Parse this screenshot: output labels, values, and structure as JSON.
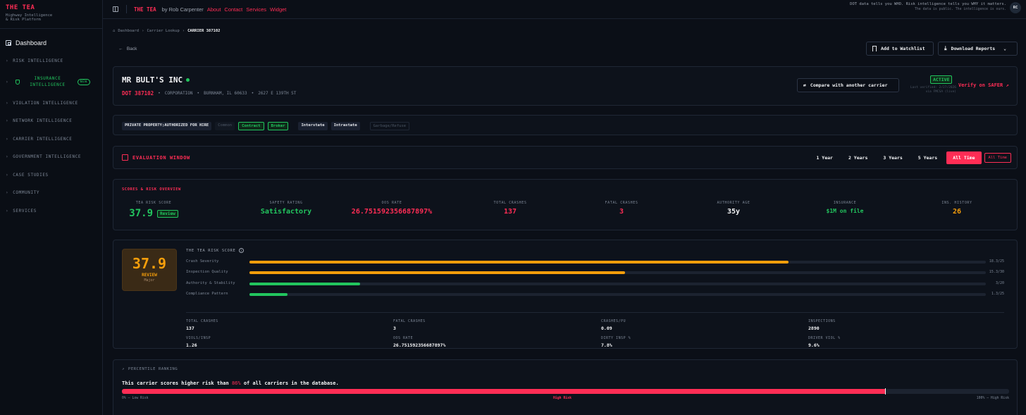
{
  "brand": {
    "title": "THE TEA",
    "subtitle_line1": "Highway Intelligence",
    "subtitle_line2": "& Risk Platform"
  },
  "sidebar": {
    "dashboard": "Dashboard",
    "items": [
      {
        "label": "RISK INTELLIGENCE"
      },
      {
        "label_line1": "INSURANCE",
        "label_line2": "INTELLIGENCE",
        "badge": "NEW",
        "active": true
      },
      {
        "label": "VIOLATION INTELLIGENCE"
      },
      {
        "label": "NETWORK INTELLIGENCE"
      },
      {
        "label": "CARRIER INTELLIGENCE"
      },
      {
        "label": "GOVERNMENT INTELLIGENCE"
      },
      {
        "label": "CASE STUDIES"
      },
      {
        "label": "COMMUNITY"
      },
      {
        "label": "SERVICES"
      }
    ]
  },
  "topbar": {
    "brand": "THE TEA",
    "by": "by Rob Carpenter",
    "links": [
      "About",
      "Contact",
      "Services",
      "Widget"
    ],
    "tagline1": "DOT data tells you WHO. Risk intelligence tells you WHY it matters.",
    "tagline2": "The data is public. The intelligence is ours.",
    "avatar": "RC"
  },
  "breadcrumb": {
    "home": "Dashboard",
    "mid": "Carrier Lookup",
    "current": "CARRIER 387102"
  },
  "back": "Back",
  "buttons": {
    "watchlist": "Add to Watchlist",
    "download": "Download Reports",
    "compare": "Compare with another carrier"
  },
  "carrier": {
    "name": "MR BULT'S INC",
    "dot": "DOT 387102",
    "type": "CORPORATION",
    "city": "BURNHAM, IL 60633",
    "address": "2627 E 139TH ST",
    "status": "ACTIVE",
    "verified_line1": "Last verified: 2/27/2026",
    "verified_line2": "via FMCSA (live)",
    "verify_link": "Verify on SAFER"
  },
  "tags": [
    {
      "text": "PRIVATE PROPERTY;AUTHORIZED FOR HIRE",
      "style": "solid"
    },
    {
      "text": "Common",
      "style": "muted"
    },
    {
      "text": "Contract",
      "style": "green"
    },
    {
      "text": "Broker",
      "style": "green"
    },
    {
      "text": "Interstate",
      "style": "solid"
    },
    {
      "text": "Intrastate",
      "style": "solid"
    },
    {
      "text": "Garbage/Refuse",
      "style": "faded"
    }
  ],
  "evaluation": {
    "title": "EVALUATION WINDOW",
    "ranges": [
      "1 Year",
      "2 Years",
      "3 Years",
      "5 Years",
      "All Time"
    ],
    "selected": "All Time",
    "badge": "All Time"
  },
  "overview": {
    "title": "SCORES & RISK OVERVIEW",
    "stats": [
      {
        "label": "TEA RISK SCORE",
        "value": "37.9",
        "badge": "Review",
        "color": "green"
      },
      {
        "label": "SAFETY RATING",
        "value": "Satisfactory",
        "color": "green"
      },
      {
        "label": "OOS RATE",
        "value": "26.751592356687897%",
        "color": "red"
      },
      {
        "label": "TOTAL CRASHES",
        "value": "137",
        "color": "red"
      },
      {
        "label": "FATAL CRASHES",
        "value": "3",
        "color": "red"
      },
      {
        "label": "AUTHORITY AGE",
        "value": "35y",
        "color": "white"
      },
      {
        "label": "INSURANCE",
        "value": "$1M on file",
        "color": "green"
      },
      {
        "label": "INS. HISTORY",
        "value": "26",
        "color": "orange"
      }
    ]
  },
  "risk_score": {
    "score": "37.9",
    "grade": "REVIEW",
    "severity": "Major",
    "title": "THE TEA RISK SCORE",
    "bars": [
      {
        "label": "Crash Severity",
        "score": "18.3/25",
        "fraction": 0.732,
        "color": "#f59e0b"
      },
      {
        "label": "Inspection Quality",
        "score": "15.3/30",
        "fraction": 0.51,
        "color": "#f59e0b"
      },
      {
        "label": "Authority & Stability",
        "score": "3/20",
        "fraction": 0.15,
        "color": "#22c55e"
      },
      {
        "label": "Compliance Pattern",
        "score": "1.3/25",
        "fraction": 0.052,
        "color": "#22c55e"
      }
    ],
    "metrics": [
      {
        "label": "TOTAL CRASHES",
        "value": "137"
      },
      {
        "label": "FATAL CRASHES",
        "value": "3"
      },
      {
        "label": "CRASHES/PU",
        "value": "0.09"
      },
      {
        "label": "INSPECTIONS",
        "value": "2890"
      },
      {
        "label": "VIOLS/INSP",
        "value": "1.26"
      },
      {
        "label": "OOS RATE",
        "value": "26.751592356687897%"
      },
      {
        "label": "DIRTY INSP %",
        "value": "7.8%"
      },
      {
        "label": "DRIVER VIOL %",
        "value": "9.6%"
      }
    ]
  },
  "percentile": {
    "title": "PERCENTILE RANKING",
    "text_before": "This carrier scores higher risk than",
    "pct": "86%",
    "text_after": "of all carriers in the database.",
    "fraction": 0.86,
    "low": "0% — Low Risk",
    "mid": "High Risk",
    "high": "100% — High Risk"
  },
  "colors": {
    "accent": "#ff2d55",
    "green": "#22c55e",
    "orange": "#f59e0b",
    "bg": "#0b0f17"
  }
}
